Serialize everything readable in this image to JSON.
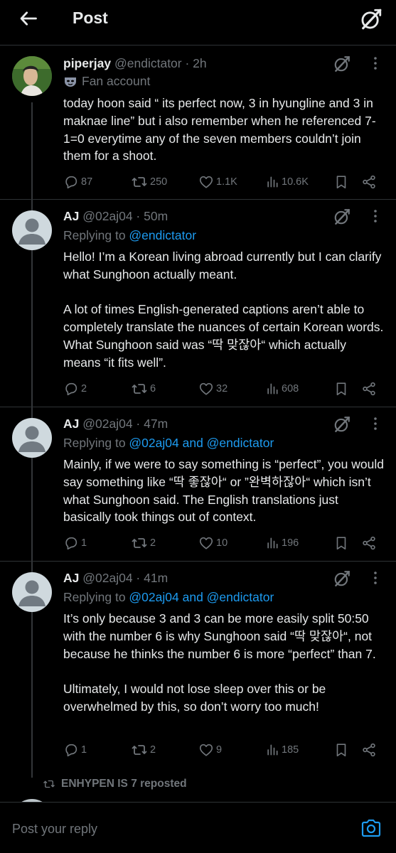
{
  "header": {
    "title": "Post"
  },
  "tweets": [
    {
      "name": "piperjay",
      "handle": "@endictator · 2h",
      "affiliation": "Fan account",
      "replying_prefix": "",
      "replying_mentions": "",
      "paragraphs": [
        "today hoon said “ its perfect now, 3 in hyungline and 3 in maknae line” but i also remember when he referenced 7-1=0 everytime any of the seven members couldn’t join them for a shoot."
      ],
      "stats": {
        "replies": "87",
        "reposts": "250",
        "likes": "1.1K",
        "views": "10.6K"
      }
    },
    {
      "name": "AJ",
      "handle": "@02aj04 · 50m",
      "replying_prefix": "Replying to ",
      "replying_mentions": "@endictator",
      "paragraphs": [
        "Hello! I’m a Korean living abroad currently but I can clarify what Sunghoon actually meant.",
        "A lot of times English-generated captions aren’t able to completely translate the nuances of certain Korean words. What Sunghoon said was “딱 맞잖아“ which actually means “it fits well”."
      ],
      "stats": {
        "replies": "2",
        "reposts": "6",
        "likes": "32",
        "views": "608"
      }
    },
    {
      "name": "AJ",
      "handle": "@02aj04 · 47m",
      "replying_prefix": "Replying to ",
      "replying_mentions": "@02aj04 and @endictator",
      "paragraphs": [
        "Mainly, if we were to say something is “perfect”, you would say something like “딱 좋잖아“ or ”완벽하잖아“ which isn’t what Sunghoon said. The English translations just basically took things out of context."
      ],
      "stats": {
        "replies": "1",
        "reposts": "2",
        "likes": "10",
        "views": "196"
      }
    },
    {
      "name": "AJ",
      "handle": "@02aj04 · 41m",
      "replying_prefix": "Replying to ",
      "replying_mentions": "@02aj04 and @endictator",
      "paragraphs": [
        "It’s only because 3 and 3 can be more easily split 50:50 with the number 6 is why Sunghoon said “딱 맞잖아“, not because he thinks the number 6 is more “perfect” than 7.",
        "Ultimately, I would not lose sleep over this or be overwhelmed by this, so don’t worry too much!"
      ],
      "stats": {
        "replies": "1",
        "reposts": "2",
        "likes": "9",
        "views": "185"
      }
    }
  ],
  "repost_notice": "ENHYPEN IS 7 reposted",
  "reply_bar": {
    "placeholder": "Post your reply"
  },
  "colors": {
    "background": "#000000",
    "text": "#e7e9ea",
    "muted": "#71767b",
    "accent": "#1d9bf0",
    "divider": "#2f3336"
  },
  "icons": {
    "back": "arrow-left-icon",
    "grok": "grok-icon",
    "more": "more-vertical-icon",
    "reply": "reply-icon",
    "repost": "repost-icon",
    "like": "heart-icon",
    "views": "views-icon",
    "bookmark": "bookmark-icon",
    "share": "share-icon",
    "camera": "camera-icon",
    "fan": "fan-mask-icon"
  }
}
